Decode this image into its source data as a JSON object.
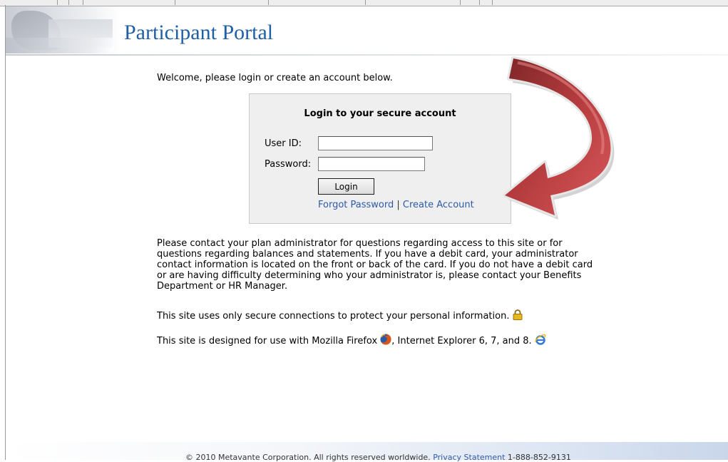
{
  "header": {
    "title": "Participant Portal"
  },
  "welcome_text": "Welcome, please login or create an account below.",
  "login": {
    "heading": "Login to your secure account",
    "user_id_label": "User ID:",
    "user_id_value": "",
    "password_label": "Password:",
    "password_value": "",
    "login_button": "Login",
    "forgot_password": "Forgot Password",
    "separator": "|",
    "create_account": "Create Account"
  },
  "info": {
    "contact_paragraph": "Please contact your plan administrator for questions regarding access to this site or for questions regarding balances and statements. If you have a debit card, your administrator contact information is located on the front or back of the card. If you do not have a debit card or are having difficulty determining who your administrator is, please contact your Benefits Department or HR Manager.",
    "secure_text": "This site uses only secure connections to protect your personal information.",
    "browser_text_prefix": "This site is designed for use with Mozilla Firefox",
    "browser_text_suffix": ", Internet Explorer 6, 7, and 8."
  },
  "icons": {
    "secure": "lock-icon",
    "firefox": "firefox-icon",
    "ie": "internet-explorer-icon",
    "arrow": "curved-arrow-annotation"
  },
  "colors": {
    "title": "#1f5fa8",
    "link": "#2e5aa8",
    "arrow": "#b83c3e",
    "login_box_bg": "#efefef"
  },
  "footer": {
    "copyright": "© 2010 Metavante Corporation. All rights reserved worldwide.",
    "privacy_link": "Privacy Statement",
    "phone": "1-888-852-9131"
  }
}
